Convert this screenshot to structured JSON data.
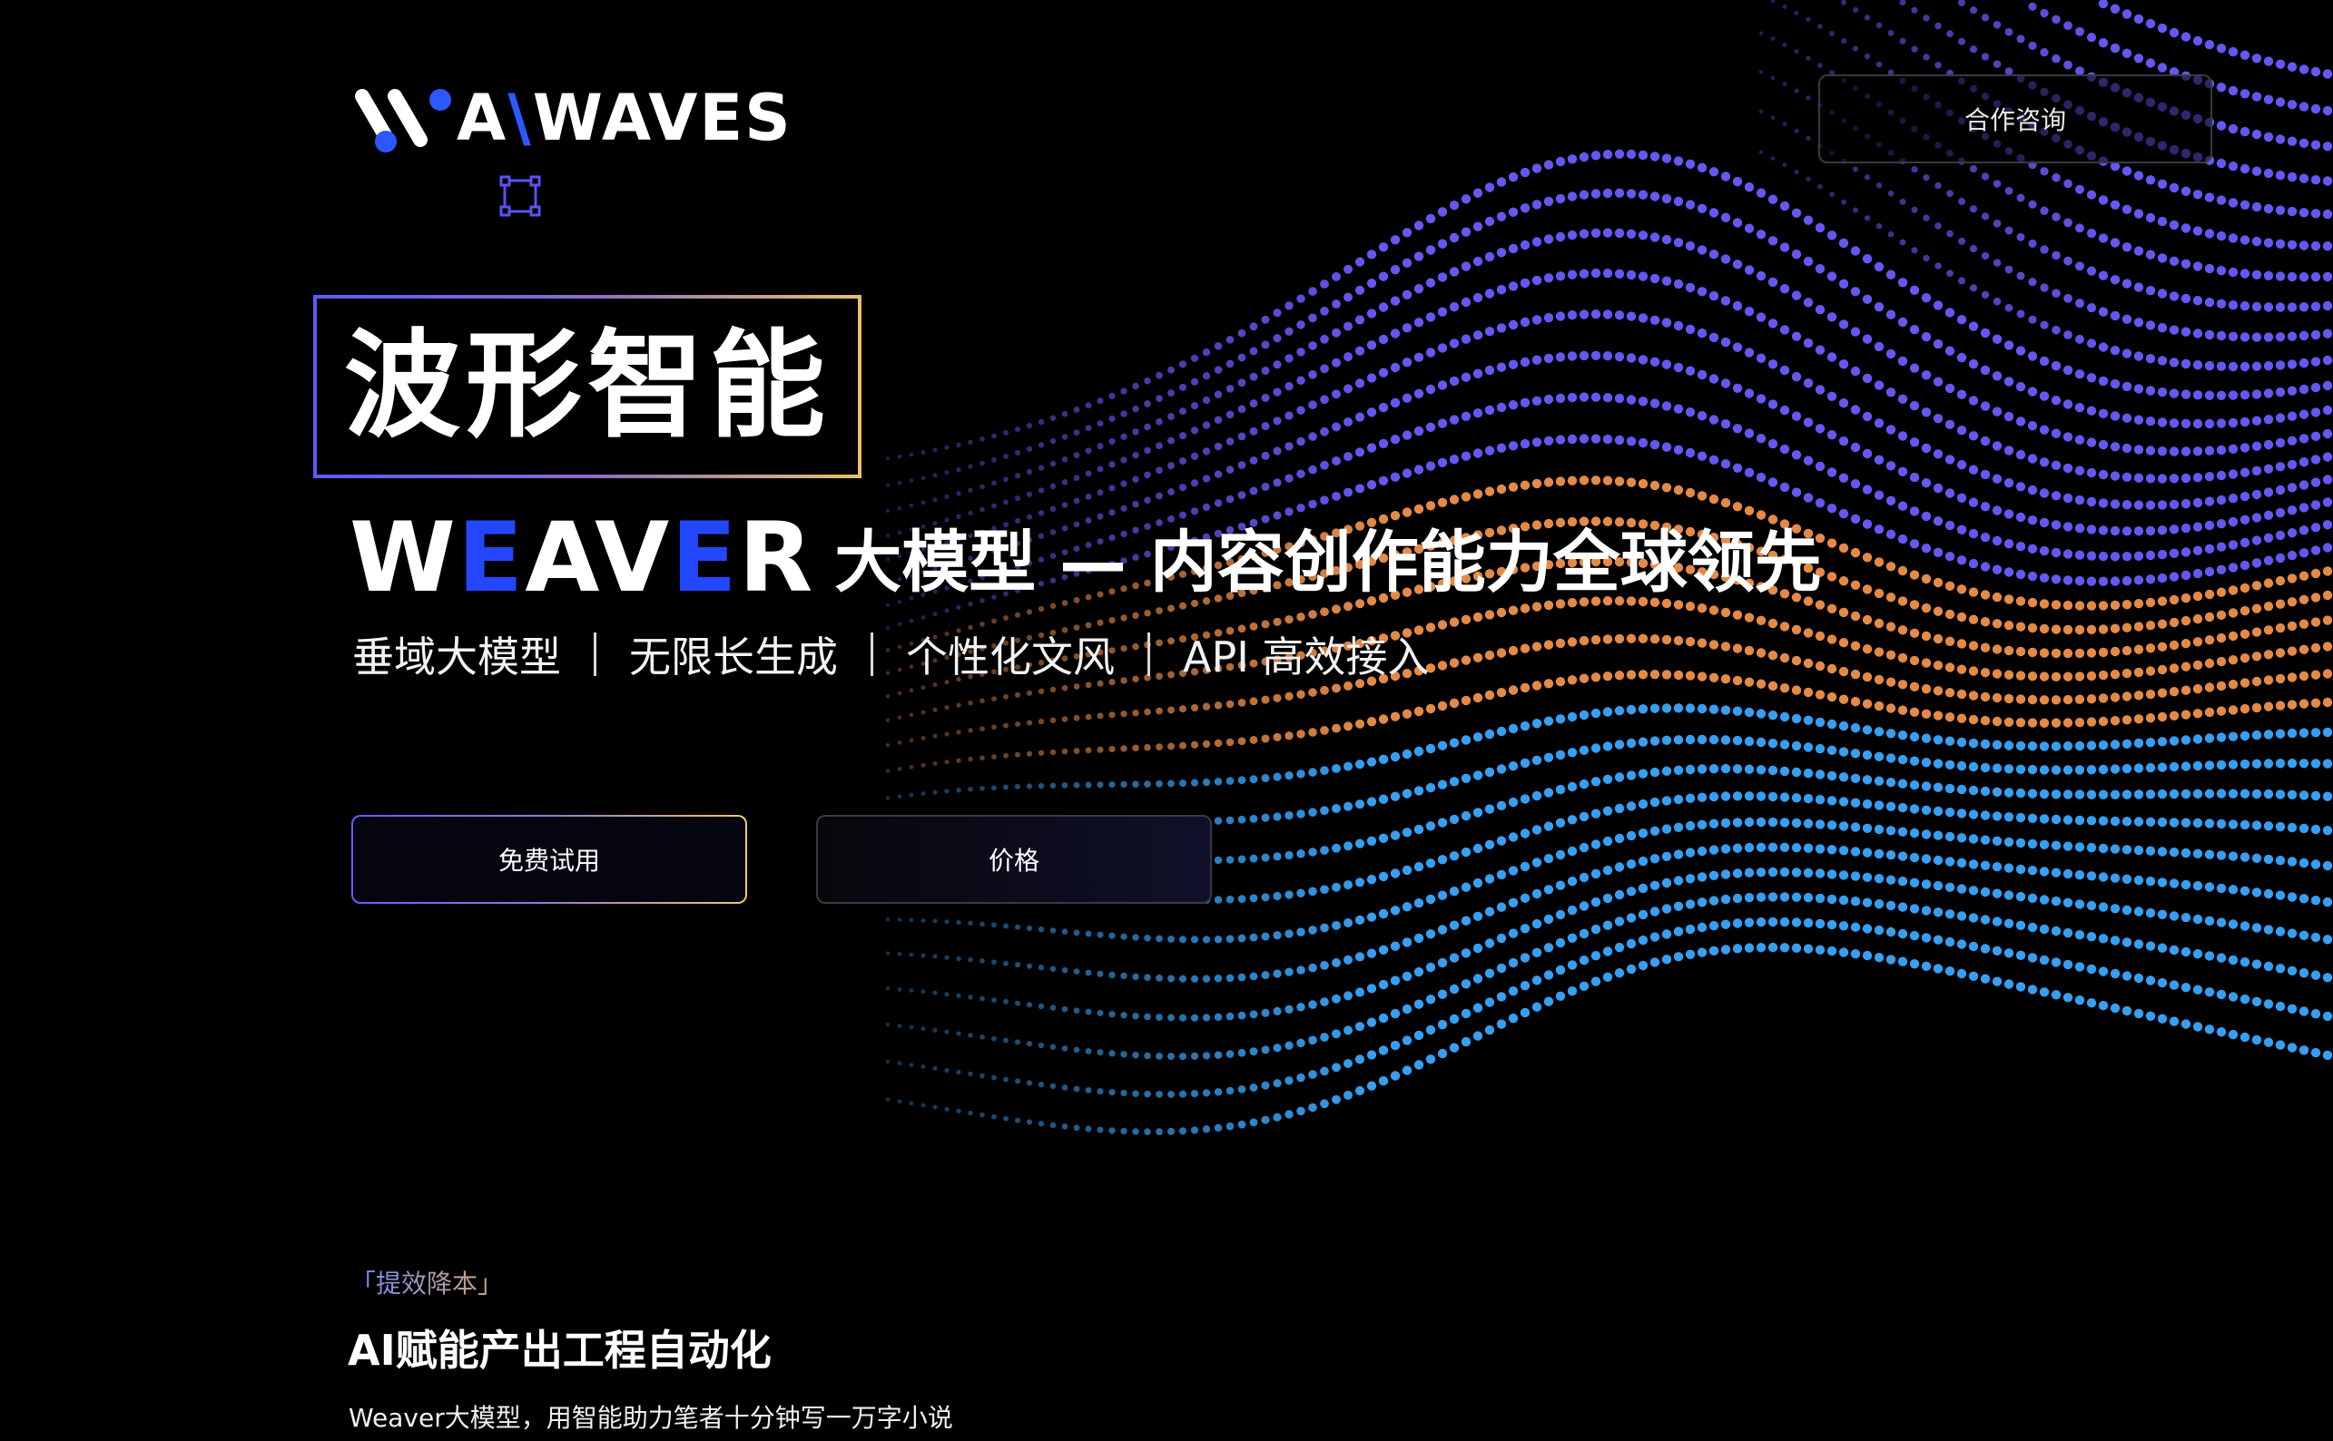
{
  "header": {
    "logo_text_a": "A",
    "logo_text_slash": "\\",
    "logo_text_rest": "WAVES",
    "consult_button": "合作咨询"
  },
  "hero": {
    "title": "波形智能",
    "weaver_w": "W",
    "weaver_e1": "E",
    "weaver_av": "AV",
    "weaver_e2": "E",
    "weaver_r": "R",
    "subtitle": "大模型 — 内容创作能力全球领先",
    "features": [
      "垂域大模型",
      "无限长生成",
      "个性化文风",
      "API 高效接入"
    ],
    "cta_trial": "免费试用",
    "cta_price": "价格"
  },
  "section": {
    "tag": "「提效降本」",
    "title": "AI赋能产出工程自动化",
    "description": "Weaver大模型，用智能助力笔者十分钟写一万字小说"
  },
  "colors": {
    "background": "#000000",
    "brand_blue": "#2346ff",
    "wave_purple": "#6a5cff",
    "wave_orange": "#f0914a",
    "wave_cyan": "#3aa8ff"
  },
  "icons": {
    "logo": "waves-logo",
    "select": "selection-box-icon"
  }
}
